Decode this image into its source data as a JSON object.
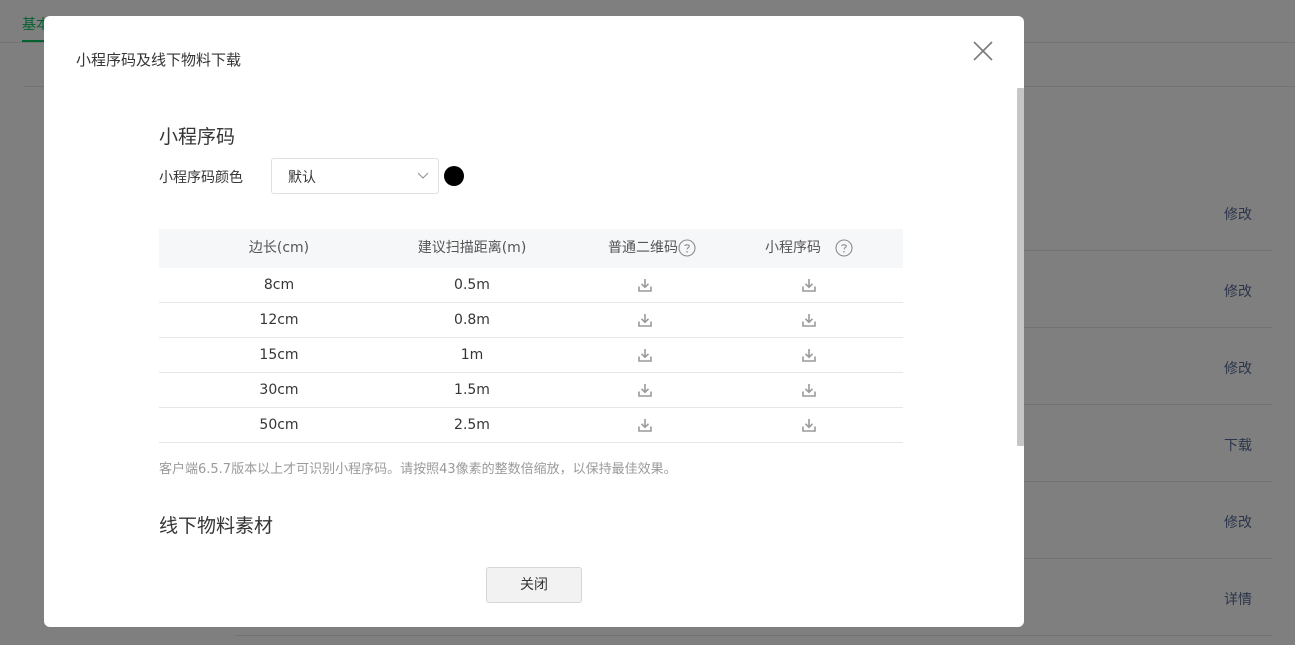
{
  "background": {
    "tab_label": "基本",
    "row_actions": [
      "修改",
      "修改",
      "修改",
      "下载",
      "修改",
      "详情"
    ]
  },
  "dialog": {
    "title": "小程序码及线下物料下载",
    "close_icon": "close-icon",
    "section_qr": {
      "title": "小程序码",
      "color_label": "小程序码颜色",
      "color_select": {
        "value": "默认",
        "icon": "chevron-down-icon"
      },
      "color_swatch": "#000000"
    },
    "table": {
      "headers": [
        "边长(cm)",
        "建议扫描距离(m)",
        "普通二维码",
        "小程序码"
      ],
      "help_icon": "question-circle-icon",
      "download_icon": "download-icon",
      "rows": [
        {
          "size": "8cm",
          "distance": "0.5m"
        },
        {
          "size": "12cm",
          "distance": "0.8m"
        },
        {
          "size": "15cm",
          "distance": "1m"
        },
        {
          "size": "30cm",
          "distance": "1.5m"
        },
        {
          "size": "50cm",
          "distance": "2.5m"
        }
      ]
    },
    "note": "客户端6.5.7版本以上才可识别小程序码。请按照43像素的整数倍缩放，以保持最佳效果。",
    "section_offline": {
      "title": "线下物料素材"
    },
    "footer": {
      "close_label": "关闭"
    }
  },
  "colors": {
    "accent_green": "#07c160",
    "link": "#576b95",
    "overlay": "rgba(0,0,0,0.5)"
  }
}
